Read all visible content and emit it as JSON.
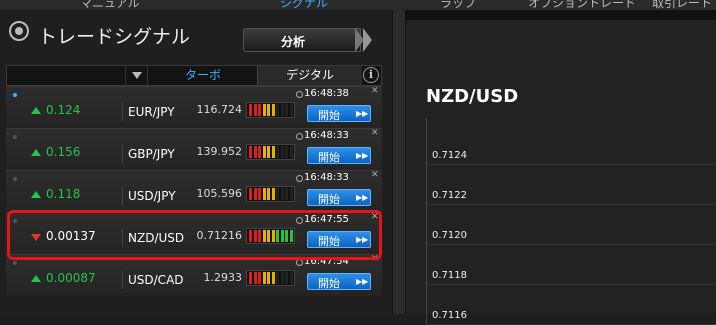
{
  "top_tabs": [
    "マニュアル",
    "シグナル",
    "ラップ",
    "オプショントレード",
    "取引レート"
  ],
  "panel": {
    "title": "トレードシグナル",
    "analyze_button": "分析",
    "header": {
      "tab_turbo": "ターボ",
      "tab_digital": "デジタル",
      "info": "i"
    },
    "start_label": "開始",
    "rows": [
      {
        "change": "0.124",
        "direction": "up",
        "pair": "EUR/JPY",
        "price": "116.724",
        "time": "16:48:38",
        "active": true,
        "strength": [
          "red",
          "red",
          "red",
          "yellow",
          "yellow",
          "yellow",
          "dark",
          "dark",
          "dark",
          "dark"
        ]
      },
      {
        "change": "0.156",
        "direction": "up",
        "pair": "GBP/JPY",
        "price": "139.952",
        "time": "16:48:33",
        "active": false,
        "strength": [
          "red",
          "red",
          "red",
          "yellow",
          "yellow",
          "yellow",
          "dark",
          "dark",
          "dark",
          "dark"
        ]
      },
      {
        "change": "0.118",
        "direction": "up",
        "pair": "USD/JPY",
        "price": "105.596",
        "time": "16:48:33",
        "active": false,
        "strength": [
          "red",
          "red",
          "red",
          "yellow",
          "yellow",
          "yellow",
          "dark",
          "dark",
          "dark",
          "dark"
        ]
      },
      {
        "change": "0.00137",
        "direction": "down",
        "pair": "NZD/USD",
        "price": "0.71216",
        "time": "16:47:55",
        "active": false,
        "strength": [
          "red",
          "red",
          "red",
          "yellow",
          "yellow",
          "yellow",
          "green",
          "green",
          "green",
          "green"
        ]
      },
      {
        "change": "0.00087",
        "direction": "up",
        "pair": "USD/CAD",
        "price": "1.2933",
        "time": "16:47:54",
        "active": false,
        "strength": [
          "red",
          "red",
          "red",
          "yellow",
          "yellow",
          "yellow",
          "dark",
          "dark",
          "dark",
          "dark"
        ]
      }
    ]
  },
  "chart": {
    "symbol": "NZD/USD",
    "y_ticks": [
      "0.7124",
      "0.7122",
      "0.7120",
      "0.7118",
      "0.7116"
    ]
  },
  "colors": {
    "up": "#29c249",
    "down": "#e53131",
    "accent": "#3ab0ff",
    "highlight": "#e4141b"
  }
}
